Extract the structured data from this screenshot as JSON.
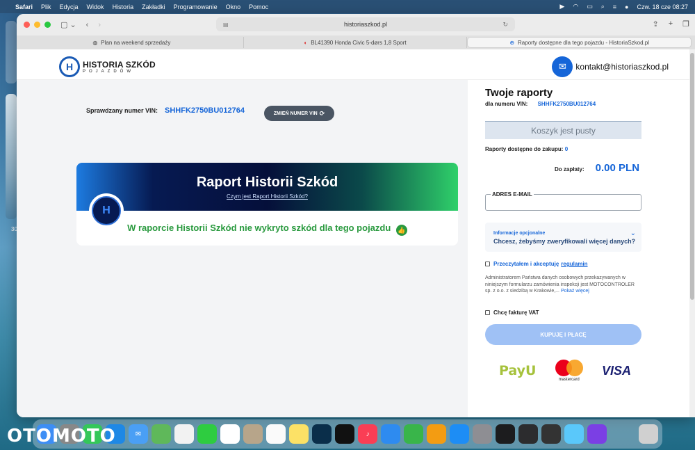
{
  "menubar": {
    "app": "Safari",
    "items": [
      "Plik",
      "Edycja",
      "Widok",
      "Historia",
      "Zakładki",
      "Programowanie",
      "Okno",
      "Pomoc"
    ],
    "datetime": "Czw. 18 cze  08:27"
  },
  "browser": {
    "url": "historiaszkod.pl",
    "tabs": [
      {
        "label": "Plan na weekend sprzedaży",
        "active": false
      },
      {
        "label": "BL41390 Honda Civic 5-dørs 1,8 Sport",
        "active": false
      },
      {
        "label": "Raporty dostępne dla tego pojazdu - HistoriaSzkod.pl",
        "active": true
      }
    ]
  },
  "header": {
    "logo_line1": "HISTORIA SZKÓD",
    "logo_line2": "POJAZDÓW",
    "email": "kontakt@historiaszkod.pl"
  },
  "vin_check": {
    "label": "Sprawdzany numer VIN:",
    "vin": "SHHFK2750BU012764",
    "change_button": "ZMIEŃ NUMER VIN"
  },
  "report": {
    "title": "Raport Historii Szkód",
    "link": "Czym jest Raport Historii Szkód?",
    "message": "W raporcie Historii Szkód nie wykryto szkód dla tego pojazdu"
  },
  "sidebar": {
    "title": "Twoje raporty",
    "vin_label": "dla numeru VIN:",
    "vin": "SHHFK2750BU012764",
    "cart_empty": "Koszyk jest pusty",
    "available_label": "Raporty dostępne do zakupu:",
    "available_count": "0",
    "pay_label": "Do zapłaty:",
    "pay_amount": "0.00 PLN",
    "email_label": "ADRES E-MAIL",
    "email_value": "",
    "optional_title": "Informacje opcjonalne",
    "optional_question": "Chcesz, żebyśmy zweryfikowali więcej danych?",
    "terms_text": "Przeczytałem i akceptuję",
    "terms_link": "regulamin",
    "legal_text": "Administratorem Państwa danych osobowych przekazywanych w niniejszym formularzu zamówienia inspekcji jest MOTOCONTROLER sp. z o.o. z siedzibą w Krakowie,...",
    "legal_more": "Pokaż więcej",
    "vat_text": "Chcę fakturę VAT",
    "buy_button": "KUPUJĘ I PŁACĘ",
    "payment_logos": [
      "PayU",
      "mastercard",
      "VISA"
    ]
  },
  "desktop": {
    "side_text": "30",
    "watermark": "OTOMOTO"
  },
  "colors": {
    "accent": "#1565d8",
    "success": "#2a9a3f",
    "button_disabled": "#9fc1f5"
  }
}
